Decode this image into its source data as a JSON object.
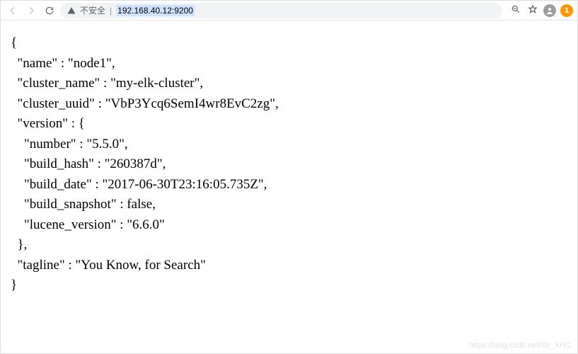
{
  "address_bar": {
    "security_label": "不安全",
    "url": "192.168.40.12:9200",
    "notif_count": "1"
  },
  "json_body": {
    "open": "{",
    "name_line": "  \"name\" : \"node1\",",
    "cluster_name_line": "  \"cluster_name\" : \"my-elk-cluster\",",
    "cluster_uuid_line": "  \"cluster_uuid\" : \"VbP3Ycq6SemI4wr8EvC2zg\",",
    "version_open": "  \"version\" : {",
    "number_line": "    \"number\" : \"5.5.0\",",
    "build_hash_line": "    \"build_hash\" : \"260387d\",",
    "build_date_line": "    \"build_date\" : \"2017-06-30T23:16:05.735Z\",",
    "build_snapshot_line": "    \"build_snapshot\" : false,",
    "lucene_line": "    \"lucene_version\" : \"6.6.0\"",
    "version_close": "  },",
    "tagline_line": "  \"tagline\" : \"You Know, for Search\"",
    "close": "}"
  },
  "watermark": "https://blog.csdn.net/Mr_XHC"
}
